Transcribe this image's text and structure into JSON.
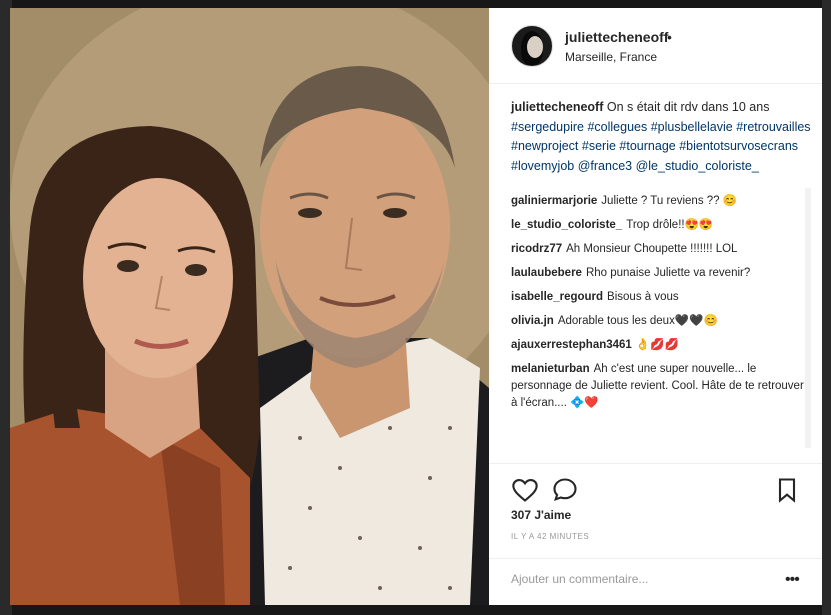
{
  "post": {
    "username": "juliettecheneoff",
    "dot": "•",
    "location": "Marseille, France",
    "caption_user": "juliettecheneoff",
    "caption_text": "On s était dit rdv dans 10 ans",
    "hashtags": [
      "#sergedupire",
      "#collegues",
      "#plusbellelavie",
      "#retrouvailles",
      "#newproject",
      "#serie",
      "#tournage",
      "#bientotsurvosecrans",
      "#lovemyjob",
      "@france3",
      "@le_studio_coloriste_"
    ]
  },
  "comments": [
    {
      "user": "galiniermarjorie",
      "text": "Juliette ? Tu reviens ?? 😊"
    },
    {
      "user": "le_studio_coloriste_",
      "text": "Trop drôle!!😍😍"
    },
    {
      "user": "ricodrz77",
      "text": "Ah Monsieur Choupette !!!!!!! LOL"
    },
    {
      "user": "laulaubebere",
      "text": "Rho punaise Juliette va revenir?"
    },
    {
      "user": "isabelle_regourd",
      "text": "Bisous à vous"
    },
    {
      "user": "olivia.jn",
      "text": "Adorable tous les deux🖤🖤😊"
    },
    {
      "user": "ajauxerrestephan3461",
      "text": "👌💋💋"
    },
    {
      "user": "melanieturban",
      "text": "Ah c'est une super nouvelle... le personnage de Juliette revient. Cool. Hâte de te retrouver à l'écran.... 💠❤️"
    }
  ],
  "actions": {
    "like_icon": "heart-icon",
    "comment_icon": "comment-bubble-icon",
    "save_icon": "bookmark-icon"
  },
  "likes": "307 J'aime",
  "time": "IL Y A 42 MINUTES",
  "comment_placeholder": "Ajouter un commentaire...",
  "more_label": "•••"
}
